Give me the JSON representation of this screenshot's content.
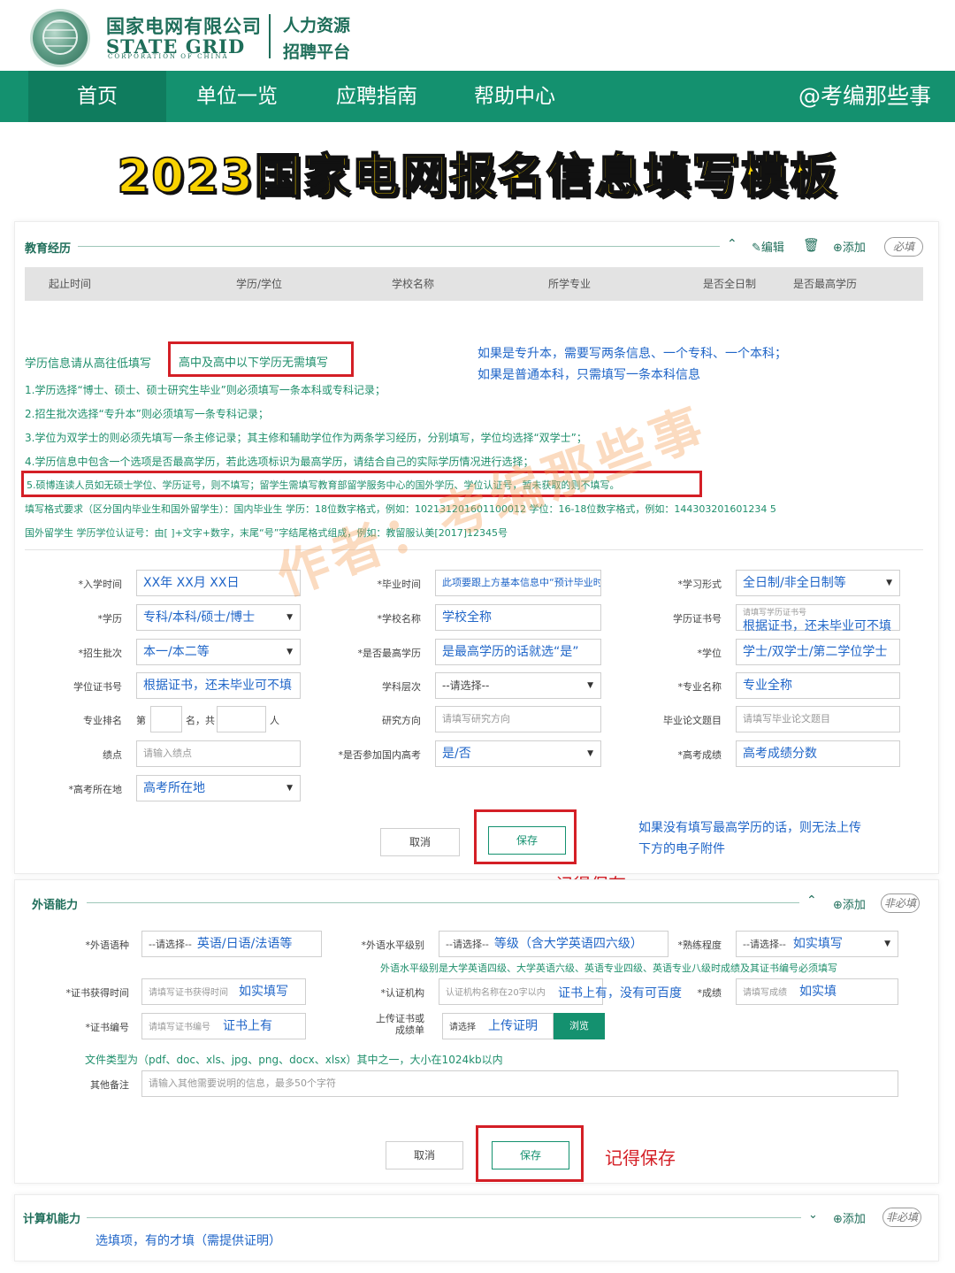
{
  "header": {
    "company_cn": "国家电网有限公司",
    "company_en": "STATE GRID",
    "company_en_sub": "CORPORATION OF CHINA",
    "platform_line1": "人力资源",
    "platform_line2": "招聘平台"
  },
  "nav": {
    "items": [
      {
        "label": "首页"
      },
      {
        "label": "单位一览"
      },
      {
        "label": "应聘指南"
      },
      {
        "label": "帮助中心"
      }
    ],
    "account": "@考编那些事"
  },
  "banner": {
    "title": "2023国家电网报名信息填写模板"
  },
  "watermark": "作者：考编那些事",
  "education": {
    "title": "教育经历",
    "edit": "编辑",
    "add": "添加",
    "required_badge": "必填",
    "columns": [
      "起止时间",
      "学历/学位",
      "学校名称",
      "所学专业",
      "是否全日制",
      "是否最高学历"
    ],
    "intro": "学历信息请从高往低填写",
    "highlight_note": "高中及高中以下学历无需填写",
    "blue_note_1": "如果是专升本，需要写两条信息、一个专科、一个本科；",
    "blue_note_2": "如果是普通本科，只需填写一条本科信息",
    "rules": [
      "1.学历选择“博士、硕士、硕士研究生毕业”则必须填写一条本科或专科记录；",
      "2.招生批次选择“专升本”则必须填写一条专科记录；",
      "3.学位为双学士的则必须先填写一条主修记录；其主修和辅助学位作为两条学习经历，分别填写，学位均选择“双学士”；",
      "4.学历信息中包含一个选项是否最高学历，若此选项标识为最高学历，请结合自己的实际学历情况进行选择；",
      "5.硕博连读人员如无硕士学位、学历证号，则不填写；留学生需填写教育部留学服务中心的国外学历、学位认证号，暂未获取的则不填写。"
    ],
    "format_1": "填写格式要求（区分国内毕业生和国外留学生）：国内毕业生 学历：18位数字格式，例如：102131201601100012 学位：16-18位数字格式，例如：144303201601234 5",
    "format_2": "国外留学生 学历学位认证号：由[ ]+文字+数字，末尾“号”字结尾格式组成，例如：教留服认美[2017]12345号",
    "form": {
      "enroll_label": "*入学时间",
      "enroll_value": "XX年 XX月 XX日",
      "grad_label": "*毕业时间",
      "grad_value": "此项要跟上方基本信息中“预计毕业时间”一致",
      "mode_label": "*学习形式",
      "mode_value": "全日制/非全日制等",
      "degree_label": "*学历",
      "degree_value": "专科/本科/硕士/博士",
      "school_label": "*学校名称",
      "school_value": "学校全称",
      "cert_label": "学历证书号",
      "cert_placeholder": "请填写学历证书号",
      "cert_value": "根据证书，还未毕业可不填",
      "batch_label": "*招生批次",
      "batch_value": "本一/本二等",
      "highest_label": "*是否最高学历",
      "highest_value": "是最高学历的话就选“是”",
      "xuewei_label": "*学位",
      "xuewei_value": "学士/双学士/第二学位学士",
      "xwcert_label": "学位证书号",
      "xwcert_value": "根据证书，还未毕业可不填",
      "level_label": "学科层次",
      "level_value": "--请选择--",
      "major_label": "*专业名称",
      "major_value": "专业全称",
      "rank_label": "专业排名",
      "rank_di": "第",
      "rank_ming": "名，共",
      "rank_ren": "人",
      "research_label": "研究方向",
      "research_placeholder": "请填写研究方向",
      "thesis_label": "毕业论文题目",
      "thesis_placeholder": "请填写毕业论文题目",
      "gpa_label": "绩点",
      "gpa_placeholder": "请输入绩点",
      "gaokao_label": "*是否参加国内高考",
      "gaokao_value": "是/否",
      "score_label": "*高考成绩",
      "score_value": "高考成绩分数",
      "place_label": "*高考所在地",
      "place_value": "高考所在地"
    },
    "cancel": "取消",
    "save": "保存",
    "upload_note_1": "如果没有填写最高学历的话，则无法上传",
    "upload_note_2": "下方的电子附件",
    "remember_save": "记得保存"
  },
  "language": {
    "title": "外语能力",
    "add": "添加",
    "badge": "非必填",
    "lang_label": "*外语语种",
    "lang_select": "--请选择--",
    "lang_value": "英语/日语/法语等",
    "level_label": "*外语水平级别",
    "level_select": "--请选择--",
    "level_value": "等级（含大学英语四六级）",
    "prof_label": "*熟练程度",
    "prof_select": "--请选择--",
    "prof_value": "如实填写",
    "level_note": "外语水平级别是大学英语四级、大学英语六级、英语专业四级、英语专业八级时成绩及其证书编号必须填写",
    "time_label": "*证书获得时间",
    "time_placeholder": "请填写证书获得时间",
    "time_value": "如实填写",
    "org_label": "*认证机构",
    "org_placeholder": "认证机构名称在20字以内",
    "org_value": "证书上有，没有可百度",
    "grade_label": "*成绩",
    "grade_placeholder": "请填写成绩",
    "grade_value": "如实填",
    "certno_label": "*证书编号",
    "certno_placeholder": "请填写证书编号",
    "certno_value": "证书上有",
    "upload_label_1": "上传证书或",
    "upload_label_2": "成绩单",
    "upload_placeholder": "请选择",
    "upload_value": "上传证明",
    "browse": "浏览",
    "file_types": "文件类型为（pdf、doc、xls、jpg、png、docx、xlsx）其中之一，大小在1024kb以内",
    "remark_label": "其他备注",
    "remark_placeholder": "请输入其他需要说明的信息，最多50个字符",
    "cancel": "取消",
    "save": "保存",
    "remember_save": "记得保存"
  },
  "computer": {
    "title": "计算机能力",
    "add": "添加",
    "badge": "非必填",
    "note": "选填项，有的才填（需提供证明）"
  },
  "colors": {
    "primary": "#14916f",
    "nav_active": "#0f7c5e",
    "red": "#d41f26",
    "blue": "#2066c8",
    "banner_yellow": "#f8d200"
  }
}
